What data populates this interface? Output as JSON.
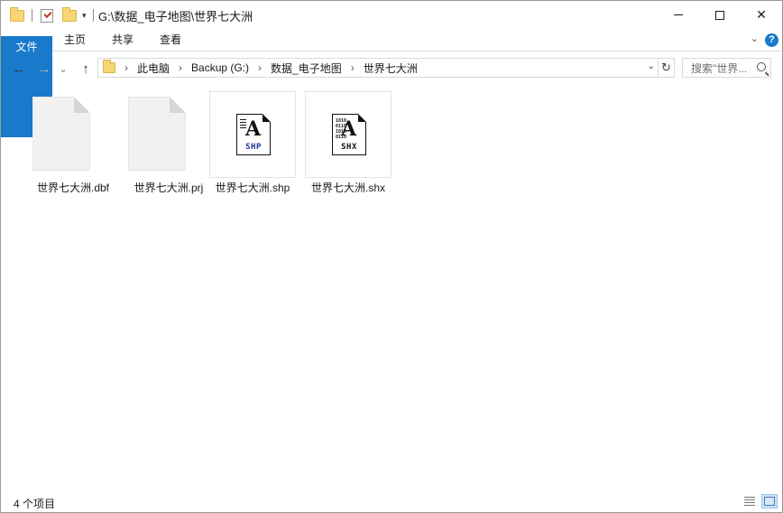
{
  "window": {
    "title": "G:\\数据_电子地图\\世界七大洲",
    "controls": {
      "minimize": "minimize",
      "maximize": "maximize",
      "close": "✕"
    }
  },
  "quick_access": {
    "dropdown": "▾"
  },
  "ribbon": {
    "tabs": [
      "文件",
      "主页",
      "共享",
      "查看"
    ],
    "collapse": "⌄",
    "help": "?"
  },
  "nav": {
    "back": "←",
    "forward": "→",
    "recent": "⌄",
    "up": "↑",
    "breadcrumb": [
      "此电脑",
      "Backup (G:)",
      "数据_电子地图",
      "世界七大洲"
    ],
    "breadcrumb_sep": "›",
    "address_dropdown": "⌄",
    "refresh": "↻",
    "search_placeholder": "搜索\"世界..."
  },
  "files": [
    {
      "name": "世界七大洲.dbf",
      "icon": "blank-document-icon"
    },
    {
      "name": "世界七大洲.prj",
      "icon": "blank-document-icon"
    },
    {
      "name": "世界七大洲.shp",
      "icon": "shp-file-icon",
      "label": "SHP"
    },
    {
      "name": "世界七大洲.shx",
      "icon": "shx-file-icon",
      "label": "SHX",
      "bits": "1010\n0110\n1010\n0110"
    }
  ],
  "status": {
    "item_count": "4 个项目"
  }
}
